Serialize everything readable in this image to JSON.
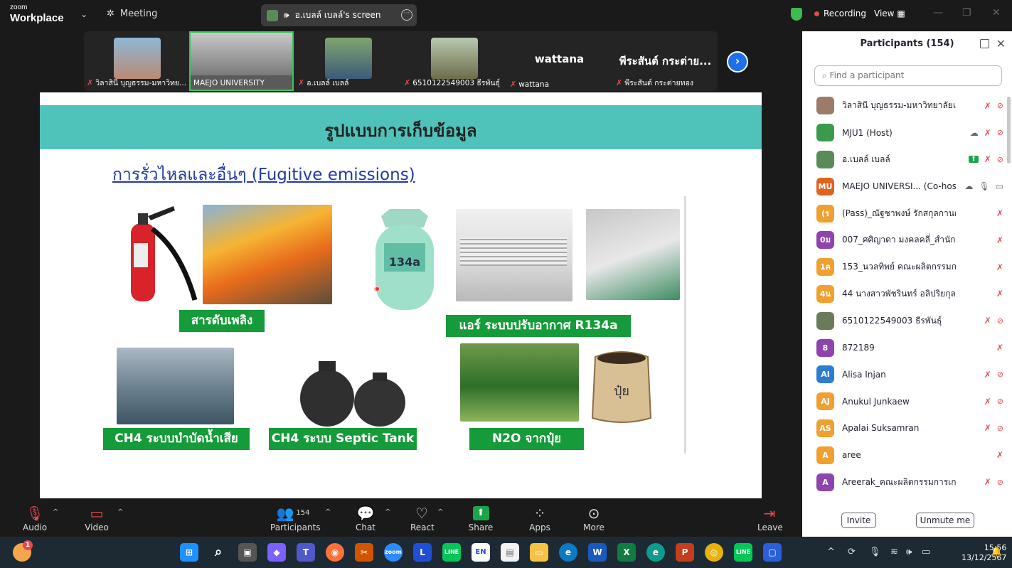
{
  "topbar": {
    "logo_small": "zoom",
    "logo_big": "Workplace",
    "meeting_label": "Meeting",
    "screen_label": "อ.เบลล์ เบลล์'s screen",
    "recording_label": "Recording",
    "view_label": "View"
  },
  "strip": {
    "tiles": [
      {
        "name": "วิลาสินี บุญธรรม-มหาวิทย..."
      },
      {
        "name": "MAEJO UNIVERSITY"
      },
      {
        "name": "อ.เบลล์ เบลล์"
      },
      {
        "name": "6510122549003 ธีรพันธุ์"
      },
      {
        "name": "wattana",
        "big": "wattana"
      },
      {
        "name": "พีระสันต์ กระต่ายทอง",
        "big": "พีระสันต์ กระต่าย..."
      }
    ]
  },
  "slide": {
    "title": "รูปแบบการเก็บข้อมูล",
    "subtitle": "การรั่วไหลและอื่นๆ (Fugitive emissions)",
    "labels": {
      "extinguisher": "สารดับเพลิง",
      "aircon": "แอร์ ระบบปรับอากาศ R134a",
      "wastewater": "CH4 ระบบบำบัดน้ำเสีย",
      "septic": "CH4 ระบบ Septic Tank",
      "fertilizer": "N2O จากปุ๋ย"
    },
    "cylinder_text": "134a",
    "sack_text": "ปุ๋ย"
  },
  "panel": {
    "title": "Participants (154)",
    "search_placeholder": "Find a participant",
    "participants": [
      {
        "initials": "",
        "color": "#9c7b6a",
        "name": "วิลาสินี บุญธรรม-มหาวิทยาลัยแ... (Me)",
        "icons": [
          "mic-off",
          "video-off"
        ]
      },
      {
        "initials": "",
        "color": "#3c9a4c",
        "name": "MJU1 (Host)",
        "icons": [
          "cloud",
          "mic-off",
          "video-off"
        ]
      },
      {
        "initials": "",
        "color": "#5b8a5a",
        "name": "อ.เบลล์ เบลล์",
        "icons": [
          "share",
          "mic-off",
          "video-off"
        ]
      },
      {
        "initials": "MU",
        "color": "#e0621f",
        "name": "MAEJO UNIVERSI... (Co-host)",
        "icons": [
          "cloud",
          "mic-on",
          "video-on"
        ]
      },
      {
        "initials": "(ร",
        "color": "#f0a030",
        "name": "(Pass)_ณัฐชาพงษ์ รักสกุลกานต์_สำนักหอ...",
        "icons": [
          "mic-off"
        ]
      },
      {
        "initials": "0ม",
        "color": "#8e44ad",
        "name": "007_ศศิญาดา มงคลคลี่_สำนักงานมหาวิทย...",
        "icons": [
          "mic-off"
        ]
      },
      {
        "initials": "1ค",
        "color": "#f0a030",
        "name": "153_นวลทิพย์ คณะผลิตกรรมการเกษตร",
        "icons": [
          "mic-off"
        ]
      },
      {
        "initials": "4น",
        "color": "#f0a030",
        "name": "44 นางสาวพัชรินทร์ อลิปริยกุล คณะผลิต...",
        "icons": [
          "mic-off"
        ]
      },
      {
        "initials": "",
        "color": "#6b7b5a",
        "name": "6510122549003 ธีรพันธุ์",
        "icons": [
          "mic-off",
          "video-off"
        ]
      },
      {
        "initials": "8",
        "color": "#8e44ad",
        "name": "872189",
        "icons": [
          "mic-off"
        ]
      },
      {
        "initials": "AI",
        "color": "#2d7dd2",
        "name": "Alisa Injan",
        "icons": [
          "mic-off",
          "video-off"
        ]
      },
      {
        "initials": "AJ",
        "color": "#f0a030",
        "name": "Anukul Junkaew",
        "icons": [
          "mic-off",
          "video-off"
        ]
      },
      {
        "initials": "AS",
        "color": "#f0a030",
        "name": "Apalai Suksamran",
        "icons": [
          "mic-off",
          "video-off"
        ]
      },
      {
        "initials": "A",
        "color": "#f0a030",
        "name": "aree",
        "icons": [
          "mic-off"
        ]
      },
      {
        "initials": "A",
        "color": "#8e44ad",
        "name": "Areerak_คณะผลิตกรรมการเกษตร",
        "icons": [
          "mic-off",
          "video-off"
        ]
      }
    ],
    "invite_label": "Invite",
    "unmute_label": "Unmute me"
  },
  "toolbar": {
    "audio": "Audio",
    "video": "Video",
    "participants": "Participants",
    "participants_count": "154",
    "chat": "Chat",
    "react": "React",
    "share": "Share",
    "apps": "Apps",
    "more": "More",
    "leave": "Leave"
  },
  "taskbar": {
    "notification_count": "1",
    "time": "15:56",
    "date": "13/12/2567",
    "tray_lang": "TH"
  }
}
